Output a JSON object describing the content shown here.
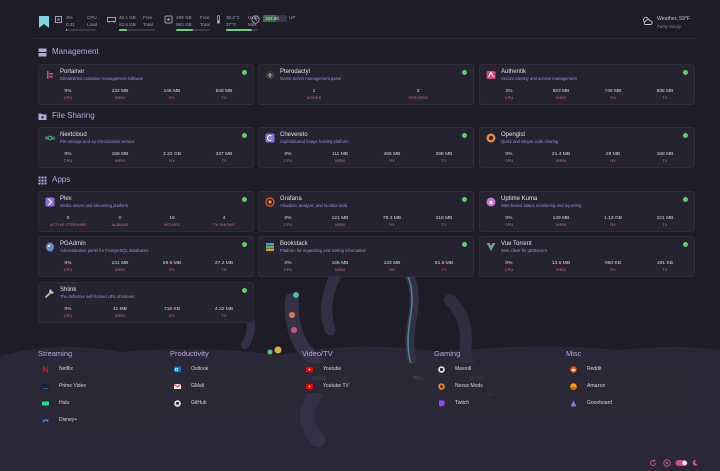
{
  "topbar": {
    "cpu": {
      "v1": "3%",
      "v2": "0.31",
      "l1": "CPU",
      "l2": "Load",
      "fill": 0.03
    },
    "mem": {
      "v1": "49.1 GB",
      "v2": "62.6 GB",
      "l1": "Free",
      "l2": "Total",
      "fill": 0.22
    },
    "disk": {
      "v1": "499 GB",
      "v2": "983 GB",
      "l1": "Free",
      "l2": "Total",
      "fill": 0.49
    },
    "temp": {
      "v1": "30.2°C",
      "v2": "37°C",
      "l1": "Used",
      "l2": "Max",
      "fill": 0.82
    },
    "uptime": {
      "v1": "154.6h",
      "l1": "UP",
      "fill": 0.55
    },
    "weather": {
      "temp": "Weather, 59°F",
      "desc": "Partly cloudy"
    }
  },
  "groups": {
    "management": "Management",
    "file_sharing": "File Sharing",
    "apps": "Apps"
  },
  "services": {
    "portainer": {
      "name": "Portainer",
      "desc": "Streamlined container management software",
      "stats": [
        {
          "v": "0%",
          "l": "CPU"
        },
        {
          "v": "132 MB",
          "l": "MEM"
        },
        {
          "v": "146 MB",
          "l": "RX"
        },
        {
          "v": "548 MB",
          "l": "TX"
        }
      ]
    },
    "pterodactyl": {
      "name": "Pterodactyl",
      "desc": "Game server management panel",
      "stats": [
        {
          "v": "1",
          "l": "NODES"
        },
        {
          "v": "3",
          "l": "SERVERS"
        }
      ]
    },
    "authentik": {
      "name": "Authentik",
      "desc": "Secure identity and access management",
      "stats": [
        {
          "v": "2%",
          "l": "CPU"
        },
        {
          "v": "923 MB",
          "l": "MEM"
        },
        {
          "v": "746 MB",
          "l": "RX"
        },
        {
          "v": "835 MB",
          "l": "TX"
        }
      ]
    },
    "nextcloud": {
      "name": "Nextcloud",
      "desc": "File storage and synchronization service",
      "stats": [
        {
          "v": "0%",
          "l": "CPU"
        },
        {
          "v": "158 MB",
          "l": "MEM"
        },
        {
          "v": "3.22 GB",
          "l": "RX"
        },
        {
          "v": "337 MB",
          "l": "TX"
        }
      ]
    },
    "chevereto": {
      "name": "Chevereto",
      "desc": "Sophisticated image hosting platform",
      "stats": [
        {
          "v": "0%",
          "l": "CPU"
        },
        {
          "v": "111 MB",
          "l": "MEM"
        },
        {
          "v": "465 MB",
          "l": "RX"
        },
        {
          "v": "298 MB",
          "l": "TX"
        }
      ]
    },
    "opengist": {
      "name": "Opengist",
      "desc": "Quick and simple code sharing",
      "stats": [
        {
          "v": "0%",
          "l": "CPU"
        },
        {
          "v": "21.4 MB",
          "l": "MEM"
        },
        {
          "v": "28 MB",
          "l": "RX"
        },
        {
          "v": "168 MB",
          "l": "TX"
        }
      ]
    },
    "plex": {
      "name": "Plex",
      "desc": "Media server and streaming platform",
      "stats": [
        {
          "v": "0",
          "l": "ACTIVE STREAMS"
        },
        {
          "v": "0",
          "l": "ALBUMS"
        },
        {
          "v": "15",
          "l": "MOVIES"
        },
        {
          "v": "4",
          "l": "TV SHOWS"
        }
      ]
    },
    "grafana": {
      "name": "Grafana",
      "desc": "Visualize, analyze, and monitor data",
      "stats": [
        {
          "v": "0%",
          "l": "CPU"
        },
        {
          "v": "121 MB",
          "l": "MEM"
        },
        {
          "v": "79.3 MB",
          "l": "RX"
        },
        {
          "v": "218 MB",
          "l": "TX"
        }
      ]
    },
    "uptimekuma": {
      "name": "Uptime Kuma",
      "desc": "Web-based status monitoring and reporting",
      "stats": [
        {
          "v": "0%",
          "l": "CPU"
        },
        {
          "v": "149 MB",
          "l": "MEM"
        },
        {
          "v": "1.13 GB",
          "l": "RX"
        },
        {
          "v": "221 MB",
          "l": "TX"
        }
      ]
    },
    "pgadmin": {
      "name": "PGAdmin",
      "desc": "Administration panel for PostgreSQL databases",
      "stats": [
        {
          "v": "0%",
          "l": "CPU"
        },
        {
          "v": "241 MB",
          "l": "MEM"
        },
        {
          "v": "59.6 MB",
          "l": "RX"
        },
        {
          "v": "27.2 MB",
          "l": "TX"
        }
      ]
    },
    "bookstack": {
      "name": "Bookstack",
      "desc": "Platform for organizing and storing information",
      "stats": [
        {
          "v": "0%",
          "l": "CPU"
        },
        {
          "v": "165 MB",
          "l": "MEM"
        },
        {
          "v": "133 MB",
          "l": "RX"
        },
        {
          "v": "81.6 MB",
          "l": "TX"
        }
      ]
    },
    "vuetorrent": {
      "name": "Vue Torrent",
      "desc": "Web client for qBittorrent",
      "stats": [
        {
          "v": "0%",
          "l": "CPU"
        },
        {
          "v": "13.6 MB",
          "l": "MEM"
        },
        {
          "v": "950 KB",
          "l": "RX"
        },
        {
          "v": "491 KB",
          "l": "TX"
        }
      ]
    },
    "shlink": {
      "name": "Shlink",
      "desc": "The definitive self-hosted URL shortener",
      "stats": [
        {
          "v": "0%",
          "l": "CPU"
        },
        {
          "v": "11 MB",
          "l": "MEM"
        },
        {
          "v": "718 KB",
          "l": "RX"
        },
        {
          "v": "4.32 MB",
          "l": "TX"
        }
      ]
    }
  },
  "bookmarks": {
    "streaming": {
      "title": "Streaming",
      "items": [
        "Netflix",
        "Prime Video",
        "Hulu",
        "Disney+"
      ]
    },
    "productivity": {
      "title": "Productivity",
      "items": [
        "Outlook",
        "GMail",
        "GitHub"
      ]
    },
    "video": {
      "title": "Video/TV",
      "items": [
        "Youtube",
        "Youtube TV"
      ]
    },
    "gaming": {
      "title": "Gaming",
      "items": [
        "Maxroll",
        "Nexus Mods",
        "Twitch"
      ]
    },
    "misc": {
      "title": "Misc",
      "items": [
        "Reddit",
        "Amazon",
        "Goonboard"
      ]
    }
  },
  "colors": {
    "background": "#1e1c27",
    "card": "#25232f",
    "accent": "#b5a8df",
    "label_pink": "#d16aa8",
    "status_green": "#5fd068"
  }
}
